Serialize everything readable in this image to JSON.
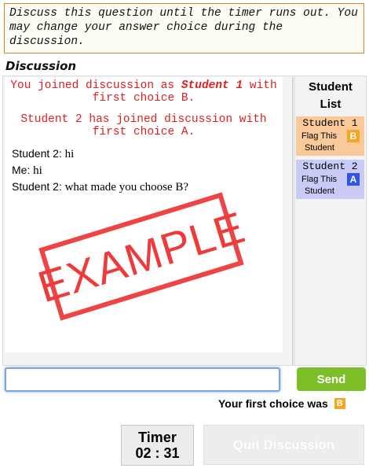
{
  "instructions": {
    "text": "Discuss this question until the timer runs out. You may change your answer choice during the discussion."
  },
  "discussion": {
    "title": "Discussion",
    "system_messages": [
      {
        "prefix": "You joined discussion as ",
        "highlight": "Student 1",
        "suffix": " with first choice B."
      },
      {
        "text": "Student 2 has joined discussion with first choice A."
      }
    ],
    "messages": [
      {
        "who": "Student 2:",
        "text": " hi"
      },
      {
        "who": "Me:",
        "text": " hi"
      },
      {
        "who": "Student 2:",
        "text": " what made you choose B?"
      }
    ],
    "stamp": "EXAMPLE"
  },
  "student_list": {
    "title_line1": "Student",
    "title_line2": "List",
    "students": [
      {
        "name": "Student 1",
        "flag_label": "Flag This",
        "choice": "B",
        "role": "Student",
        "color": "#f9c999",
        "badge_color": "#f5a623"
      },
      {
        "name": "Student 2",
        "flag_label": "Flag This",
        "choice": "A",
        "role": "Student",
        "color": "#c9cbf6",
        "badge_color": "#2f55e6"
      }
    ]
  },
  "composer": {
    "input_value": "",
    "input_placeholder": "",
    "send_label": "Send"
  },
  "first_choice": {
    "label": "Your first choice was",
    "choice": "B"
  },
  "timer": {
    "label": "Timer",
    "value": "02 : 31"
  },
  "quit_button": {
    "label": "Quit Discussion",
    "disabled": true
  }
}
